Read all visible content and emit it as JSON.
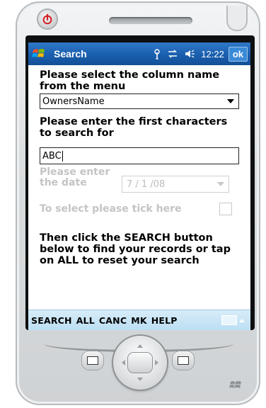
{
  "titlebar": {
    "title": "Search",
    "time": "12:22",
    "ok_label": "ok",
    "icons": [
      "windows-start-icon",
      "antenna-icon",
      "connectivity-icon",
      "speaker-icon"
    ]
  },
  "form": {
    "column_prompt": "Please select the column name from the menu",
    "column_selected": "OwnersName",
    "search_prompt": "Please enter the first characters to search for",
    "search_value": "ABC",
    "date_label": "Please enter the date",
    "date_value": "7 / 1 /08",
    "tick_label": "To select please tick here",
    "tick_checked": false,
    "info_text": "Then click the SEARCH button below to find your records or tap on ALL to reset your search"
  },
  "menubar": {
    "items": [
      "SEARCH",
      "ALL",
      "CANC",
      "MK",
      "HELP"
    ]
  },
  "colors": {
    "titlebar": "#1a5fae",
    "menubar": "#bcdff3",
    "disabled_text": "#c4c4c4",
    "power_red": "#d21f26"
  }
}
